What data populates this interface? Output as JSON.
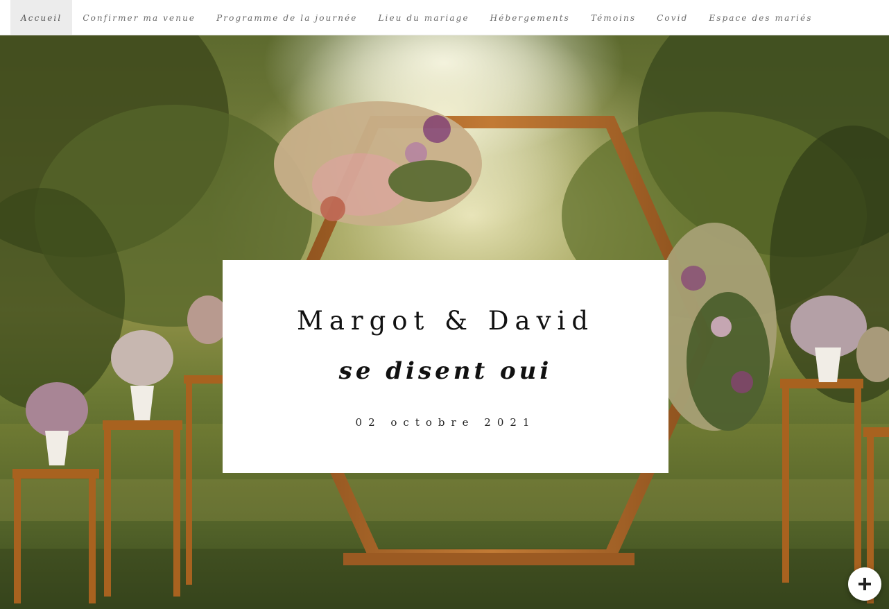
{
  "nav": {
    "items": [
      {
        "label": "Accueil",
        "active": true
      },
      {
        "label": "Confirmer ma venue",
        "active": false
      },
      {
        "label": "Programme de la journée",
        "active": false
      },
      {
        "label": "Lieu du mariage",
        "active": false
      },
      {
        "label": "Hébergements",
        "active": false
      },
      {
        "label": "Témoins",
        "active": false
      },
      {
        "label": "Covid",
        "active": false
      },
      {
        "label": "Espace des mariés",
        "active": false
      }
    ]
  },
  "hero": {
    "names": "Margot & David",
    "tagline": "se disent oui",
    "date": "02 octobre 2021"
  },
  "fab": {
    "icon": "plus-icon"
  },
  "colors": {
    "nav_active_bg": "#ececec",
    "nav_text": "#6a6a6a",
    "card_bg": "#ffffff",
    "text_dark": "#111111"
  }
}
